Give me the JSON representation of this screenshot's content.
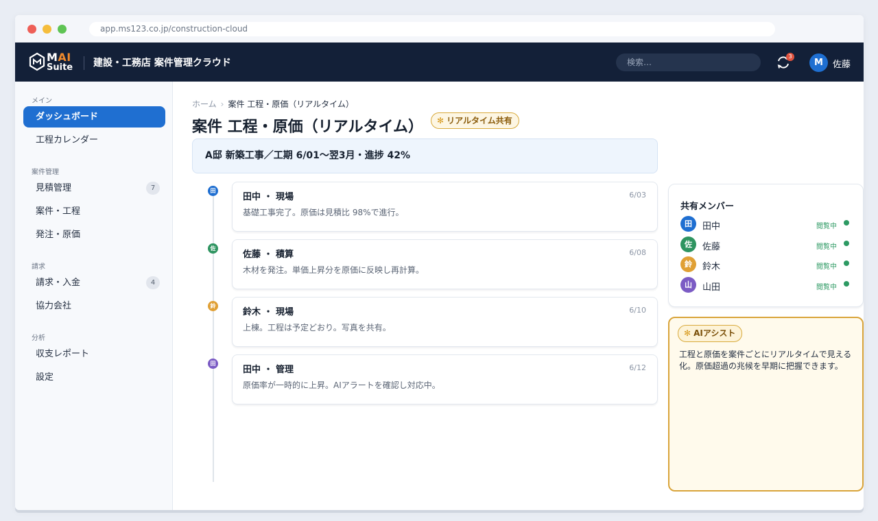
{
  "browser": {
    "url": "app.ms123.co.jp/construction-cloud"
  },
  "appbar": {
    "logo_main_m": "M",
    "logo_main_ai": "AI",
    "logo_sub": "Suite",
    "title": "建設・工務店 案件管理クラウド",
    "search_placeholder": "検索…",
    "notification_count": "3",
    "user_initial": "M",
    "user_name": "佐藤"
  },
  "sidebar": {
    "sections": [
      {
        "label": "メイン"
      },
      {
        "label": "案件管理"
      },
      {
        "label": "請求"
      },
      {
        "label": "分析"
      }
    ],
    "items": [
      {
        "label": "ダッシュボード",
        "active": true
      },
      {
        "label": "工程カレンダー"
      },
      {
        "label": "見積管理",
        "count": "7"
      },
      {
        "label": "案件・工程"
      },
      {
        "label": "発注・原価"
      },
      {
        "label": "請求・入金",
        "count": "4"
      },
      {
        "label": "協力会社"
      },
      {
        "label": "収支レポート"
      },
      {
        "label": "設定"
      }
    ]
  },
  "main": {
    "breadcrumb": {
      "home": "ホーム",
      "separator": "›",
      "current": "案件 工程・原価（リアルタイム）"
    },
    "title": "案件 工程・原価（リアルタイム）",
    "realtime_badge": "リアルタイム共有",
    "project_banner": "A邸 新築工事／工期 6/01〜翌3月・進捗 42%",
    "timeline": [
      {
        "initial": "田",
        "color": "#1f6fd1",
        "author": "田中 ・ 現場",
        "date": "6/03",
        "text": "基礎工事完了。原価は見積比 98%で進行。"
      },
      {
        "initial": "佐",
        "color": "#2e9460",
        "author": "佐藤 ・ 積算",
        "date": "6/08",
        "text": "木材を発注。単価上昇分を原価に反映し再計算。"
      },
      {
        "initial": "鈴",
        "color": "#e0a035",
        "author": "鈴木 ・ 現場",
        "date": "6/10",
        "text": "上棟。工程は予定どおり。写真を共有。"
      },
      {
        "initial": "田",
        "color": "#7b5bc4",
        "author": "田中 ・ 管理",
        "date": "6/12",
        "text": "原価率が一時的に上昇。AIアラートを確認し対応中。"
      }
    ]
  },
  "members": {
    "title": "共有メンバー",
    "list": [
      {
        "initial": "田",
        "name": "田中",
        "status": "閲覧中",
        "color": "#1f6fd1"
      },
      {
        "initial": "佐",
        "name": "佐藤",
        "status": "閲覧中",
        "color": "#2e9460"
      },
      {
        "initial": "鈴",
        "name": "鈴木",
        "status": "閲覧中",
        "color": "#e0a035"
      },
      {
        "initial": "山",
        "name": "山田",
        "status": "閲覧中",
        "color": "#7b5bc4"
      }
    ]
  },
  "ai_assist": {
    "badge": "AIアシスト",
    "text": "工程と原価を案件ごとにリアルタイムで見える化。原価超過の兆候を早期に把握できます。"
  },
  "colors": {
    "accent": "#1f6fd1",
    "header_bg": "#132038",
    "gold": "#d9a43a",
    "online": "#2d9a63"
  },
  "icons": {
    "window_close": "red-dot",
    "window_minimize": "yellow-dot",
    "window_maximize": "green-dot",
    "sync": "sync-icon",
    "spark": "spark-icon"
  }
}
